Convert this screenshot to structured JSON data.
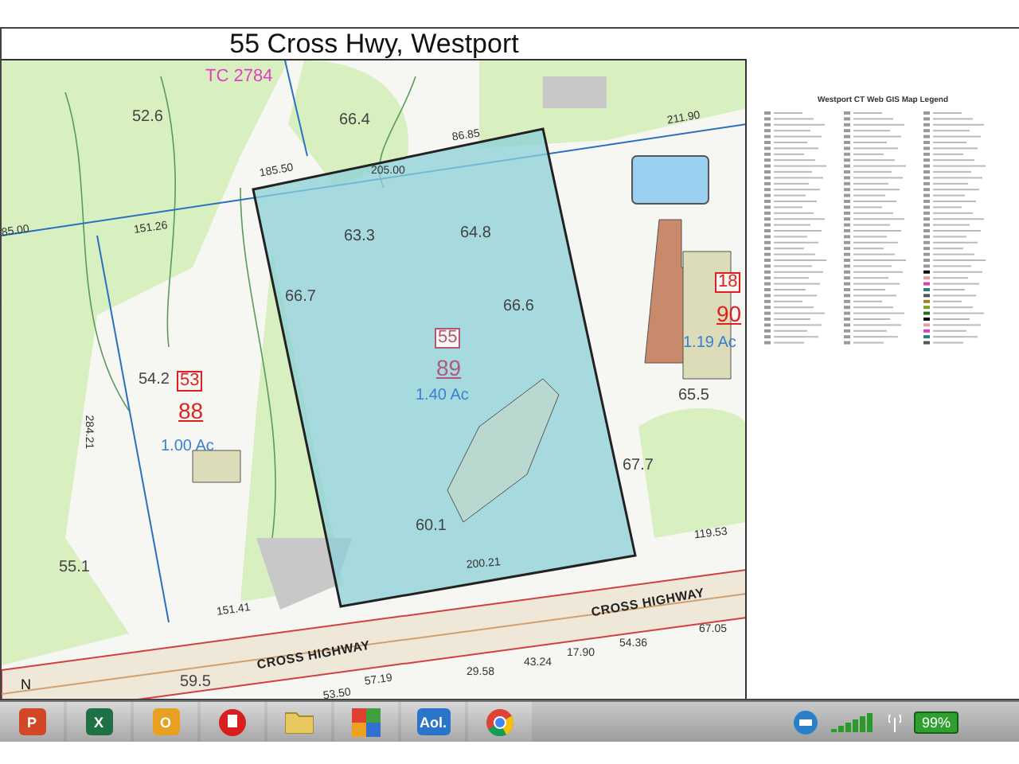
{
  "map": {
    "title": "55 Cross Hwy, Westport",
    "labels": [
      {
        "kind": "tc",
        "text": "TC 2784"
      },
      {
        "kind": "spot",
        "text": "52.6"
      },
      {
        "kind": "spot",
        "text": "66.4"
      },
      {
        "kind": "dim",
        "text": "86.85"
      },
      {
        "kind": "dim",
        "text": "211.90"
      },
      {
        "kind": "dim",
        "text": "185.50"
      },
      {
        "kind": "dim",
        "text": "205.00"
      },
      {
        "kind": "dim",
        "text": "85.00"
      },
      {
        "kind": "dim",
        "text": "151.26"
      },
      {
        "kind": "spot",
        "text": "63.3"
      },
      {
        "kind": "spot",
        "text": "64.8"
      },
      {
        "kind": "spot",
        "text": "66.7"
      },
      {
        "kind": "spot",
        "text": "66.6"
      },
      {
        "kind": "house",
        "text": "55",
        "selected": true
      },
      {
        "kind": "lot",
        "text": "89",
        "selected": true
      },
      {
        "kind": "acre",
        "text": "1.40 Ac"
      },
      {
        "kind": "house",
        "text": "18",
        "selected": false
      },
      {
        "kind": "lot",
        "text": "90",
        "selected": false
      },
      {
        "kind": "acre",
        "text": "1.19 Ac"
      },
      {
        "kind": "spot",
        "text": "54.2"
      },
      {
        "kind": "house",
        "text": "53",
        "selected": false
      },
      {
        "kind": "lot",
        "text": "88",
        "selected": false
      },
      {
        "kind": "acre",
        "text": "1.00 Ac"
      },
      {
        "kind": "dim",
        "text": "284.21"
      },
      {
        "kind": "spot",
        "text": "65.5"
      },
      {
        "kind": "spot",
        "text": "67.7"
      },
      {
        "kind": "spot",
        "text": "60.1"
      },
      {
        "kind": "dim",
        "text": "200.21"
      },
      {
        "kind": "dim",
        "text": "119.53"
      },
      {
        "kind": "spot",
        "text": "55.1"
      },
      {
        "kind": "dim",
        "text": "151.41"
      },
      {
        "kind": "road",
        "text": "CROSS HIGHWAY"
      },
      {
        "kind": "road",
        "text": "CROSS HIGHWAY"
      },
      {
        "kind": "spot",
        "text": "59.5"
      },
      {
        "kind": "dim",
        "text": "53.50"
      },
      {
        "kind": "dim",
        "text": "57.19"
      },
      {
        "kind": "dim",
        "text": "29.58"
      },
      {
        "kind": "dim",
        "text": "43.24"
      },
      {
        "kind": "dim",
        "text": "17.90"
      },
      {
        "kind": "dim",
        "text": "54.36"
      },
      {
        "kind": "dim",
        "text": "67.05"
      },
      {
        "kind": "north",
        "text": "N"
      }
    ]
  },
  "legend": {
    "title": "Westport CT Web GIS Map Legend"
  },
  "taskbar": {
    "apps": [
      {
        "kind": "powerpoint",
        "glyph": "P"
      },
      {
        "kind": "excel",
        "glyph": "X"
      },
      {
        "kind": "outlook",
        "glyph": "O"
      },
      {
        "kind": "acrobat"
      },
      {
        "kind": "folder"
      },
      {
        "kind": "tiles"
      },
      {
        "kind": "aol",
        "glyph": "Aol."
      },
      {
        "kind": "chrome"
      }
    ],
    "battery": "99%"
  }
}
